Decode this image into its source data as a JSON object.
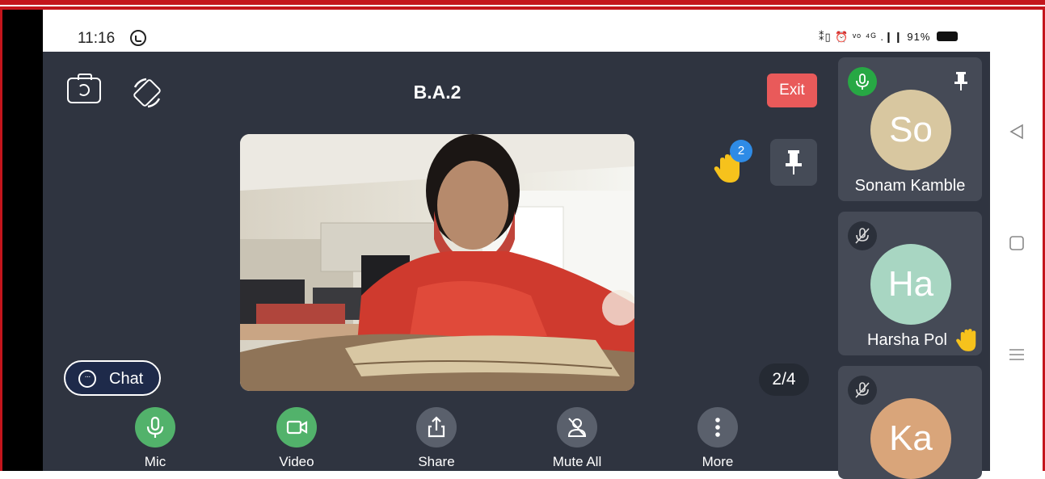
{
  "status_bar": {
    "time": "11:16",
    "icons_text": "⁑▯ ⏰ ᵛᵒ ⁴ᴳ .❙❙ 91%",
    "battery": "91%"
  },
  "meeting": {
    "title": "B.A.2",
    "exit_label": "Exit",
    "raised_hands_count": "2",
    "page_indicator": "2/4"
  },
  "chat": {
    "label": "Chat",
    "bubble": "···"
  },
  "controls": [
    {
      "label": "Mic",
      "icon": "mic-icon"
    },
    {
      "label": "Video",
      "icon": "video-icon"
    },
    {
      "label": "Share",
      "icon": "share-icon"
    },
    {
      "label": "Mute All",
      "icon": "mute-all-icon"
    },
    {
      "label": "More",
      "icon": "more-vertical-icon"
    }
  ],
  "participants": [
    {
      "initials": "So",
      "name": "Sonam Kamble",
      "mic": "on",
      "avatar_color": "#d8c7a0",
      "pinned": true
    },
    {
      "initials": "Ha",
      "name": "Harsha Pol",
      "mic": "off",
      "avatar_color": "#a8d6c2",
      "hand_raised": true
    },
    {
      "initials": "Ka",
      "name": "",
      "mic": "off",
      "avatar_color": "#d9a57a"
    }
  ],
  "colors": {
    "stage_bg": "#2f3440",
    "exit": "#e95a5a",
    "mic_green": "#52b26b",
    "badge_blue": "#2e8be6",
    "frame_red": "#c4151c"
  }
}
